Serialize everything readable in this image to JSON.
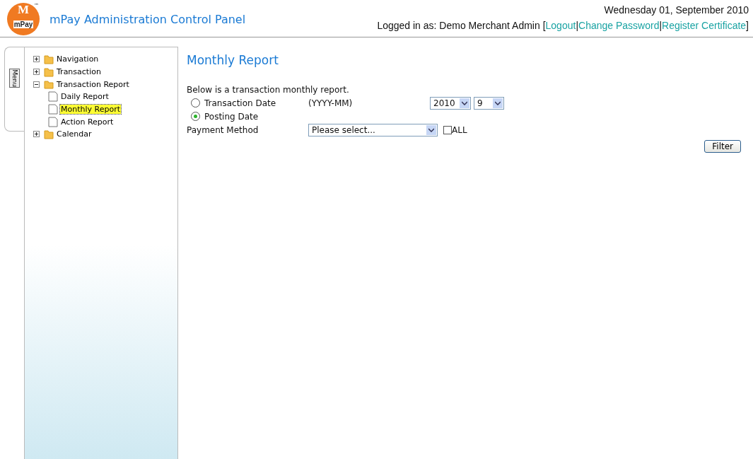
{
  "header": {
    "logo": {
      "letter": "M",
      "text": "mPay",
      "trademark": "™"
    },
    "title": "mPay Administration Control Panel",
    "date": "Wednesday 01, September 2010",
    "login_prefix": "Logged in as: Demo Merchant Admin [",
    "links": [
      "Logout",
      "Change Password",
      "Register Certificate"
    ],
    "separator": "|",
    "login_suffix": "]"
  },
  "menu_tab": "Menu",
  "tree": [
    {
      "label": "Navigation",
      "kind": "folder",
      "expanded": false,
      "selected": false
    },
    {
      "label": "Transaction",
      "kind": "folder",
      "expanded": false,
      "selected": false
    },
    {
      "label": "Transaction Report",
      "kind": "folder",
      "expanded": true,
      "selected": false,
      "children": [
        {
          "label": "Daily Report",
          "kind": "page",
          "selected": false
        },
        {
          "label": "Monthly Report",
          "kind": "page",
          "selected": true
        },
        {
          "label": "Action Report",
          "kind": "page",
          "selected": false
        }
      ]
    },
    {
      "label": "Calendar",
      "kind": "folder",
      "expanded": false,
      "selected": false
    }
  ],
  "content": {
    "title": "Monthly Report",
    "intro": "Below is a transaction monthly report.",
    "date_options": [
      {
        "label": "Transaction Date",
        "selected": false
      },
      {
        "label": "Posting Date",
        "selected": true
      }
    ],
    "format_hint": "(YYYY-MM)",
    "year": "2010",
    "month": "9",
    "payment_method_label": "Payment Method",
    "payment_method": {
      "value": "Please select..."
    },
    "all_checkbox": {
      "label": "ALL",
      "checked": false
    },
    "filter_button": "Filter"
  }
}
